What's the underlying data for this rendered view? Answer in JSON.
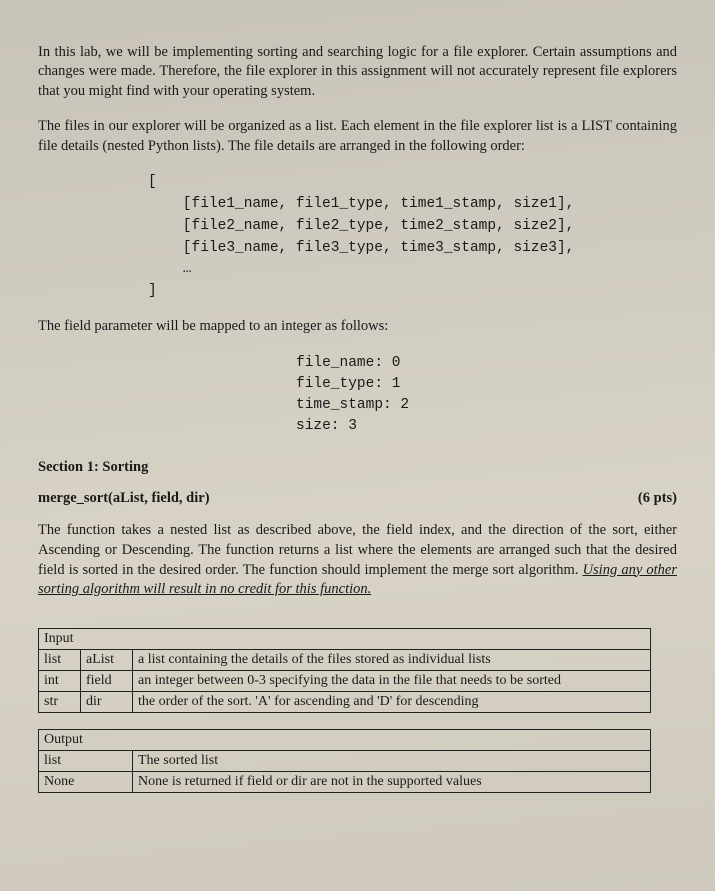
{
  "intro1": "In this lab, we will be implementing sorting and searching logic for a file explorer. Certain assumptions and changes were made. Therefore, the file explorer in this assignment will not accurately represent file explorers that you might find with your operating system.",
  "intro2": "The files in our explorer will be organized as a list. Each element in the file explorer list is a LIST containing file details (nested Python lists). The file details are arranged in the following order:",
  "code_list": "[\n    [file1_name, file1_type, time1_stamp, size1],\n    [file2_name, file2_type, time2_stamp, size2],\n    [file3_name, file3_type, time3_stamp, size3],\n    …\n]",
  "map_intro": "The field parameter will be mapped to an integer as follows:",
  "map_block": "file_name: 0\nfile_type: 1\ntime_stamp: 2\nsize: 3",
  "section1": "Section 1: Sorting",
  "func_sig": "merge_sort(aList, field, dir)",
  "points": "(6 pts)",
  "func_desc_pre": "The function takes a nested list as described above, the field index, and the direction of the sort, either Ascending or Descending. The function returns a list where the elements are arranged such that the desired field is sorted in the desired order. The function should implement the merge sort algorithm. ",
  "func_desc_under": "Using any other sorting algorithm will result in no credit for this function.",
  "input": {
    "header": "Input",
    "rows": [
      {
        "type": "list",
        "name": "aList",
        "desc": "a list containing the details of the files stored as individual lists"
      },
      {
        "type": "int",
        "name": "field",
        "desc": "an integer between 0-3 specifying the data in the file that needs to be sorted"
      },
      {
        "type": "str",
        "name": "dir",
        "desc": "the order of the sort. 'A' for ascending and 'D' for descending"
      }
    ]
  },
  "output": {
    "header": "Output",
    "rows": [
      {
        "type": "list",
        "desc": "The sorted list"
      },
      {
        "type": "None",
        "desc": "None is returned if field or dir are not in the supported values"
      }
    ]
  }
}
